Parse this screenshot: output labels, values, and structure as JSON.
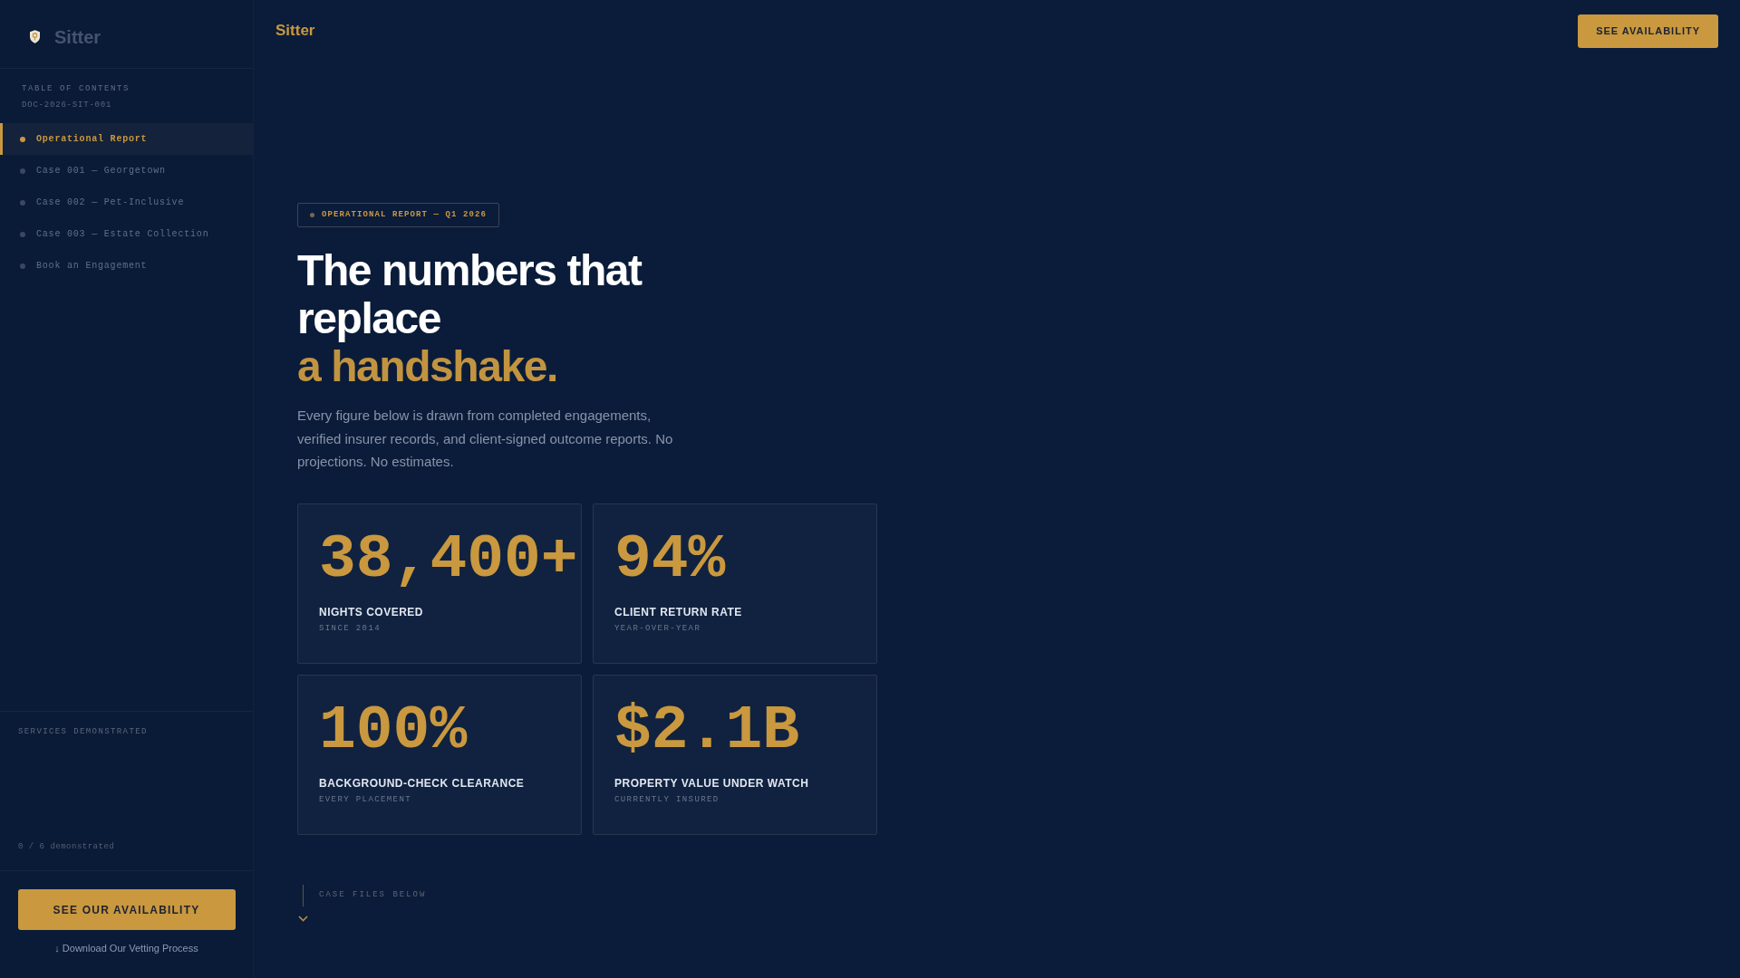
{
  "sidebar": {
    "brand": "Sitter",
    "toc_title": "TABLE OF CONTENTS",
    "doc_id": "DOC-2026-SIT-001",
    "items": [
      {
        "label": "Operational Report",
        "selected": true
      },
      {
        "label": "Case 001 — Georgetown",
        "selected": false
      },
      {
        "label": "Case 002 — Pet-Inclusive",
        "selected": false
      },
      {
        "label": "Case 003 — Estate Collection",
        "selected": false
      },
      {
        "label": "Book an Engagement",
        "selected": false
      }
    ],
    "services": {
      "title": "SERVICES DEMONSTRATED",
      "count": "0 / 6 demonstrated"
    },
    "cta": "SEE OUR AVAILABILITY",
    "download_link": "↓ Download Our Vetting Process"
  },
  "header": {
    "title": "Sitter",
    "button": "SEE AVAILABILITY"
  },
  "hero": {
    "badge": "OPERATIONAL REPORT — Q1 2026",
    "title": "The numbers that replace",
    "title_accent": "a handshake.",
    "intro": "Every figure below is drawn from completed engagements, verified insurer records, and client-signed outcome reports. No projections. No estimates."
  },
  "stats": [
    {
      "value": "38,400+",
      "label": "NIGHTS COVERED",
      "note": "SINCE 2014"
    },
    {
      "value": "94%",
      "label": "CLIENT RETURN RATE",
      "note": "YEAR-OVER-YEAR"
    },
    {
      "value": "100%",
      "label": "BACKGROUND-CHECK CLEARANCE",
      "note": "EVERY PLACEMENT"
    },
    {
      "value": "$2.1B",
      "label": "PROPERTY VALUE UNDER WATCH",
      "note": "CURRENTLY INSURED"
    }
  ],
  "scroll_hint": {
    "label": "CASE FILES BELOW"
  }
}
